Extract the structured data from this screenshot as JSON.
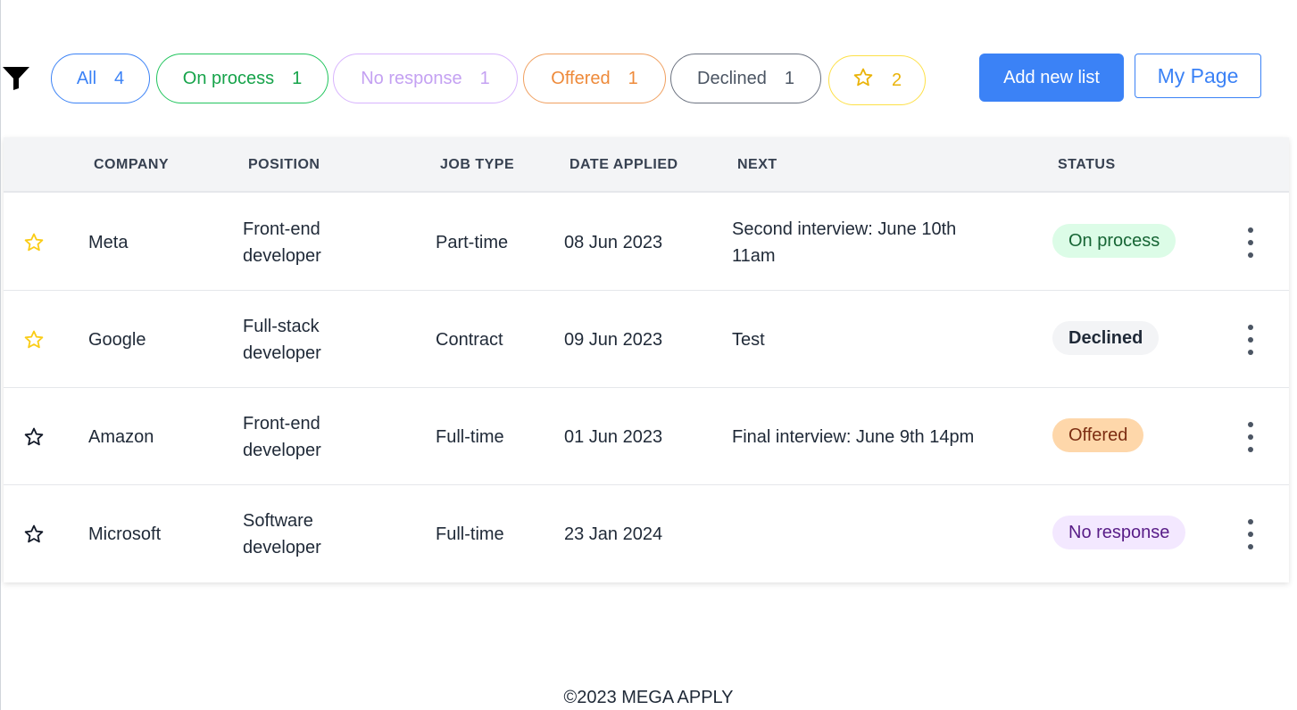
{
  "filters": {
    "icon": "filter-icon",
    "pills": [
      {
        "key": "all",
        "label": "All",
        "count": "4"
      },
      {
        "key": "onprocess",
        "label": "On process",
        "count": "1"
      },
      {
        "key": "noresponse",
        "label": "No response",
        "count": "1"
      },
      {
        "key": "offered",
        "label": "Offered",
        "count": "1"
      },
      {
        "key": "declined",
        "label": "Declined",
        "count": "1"
      },
      {
        "key": "starred",
        "icon": "star-icon",
        "count": "2"
      }
    ]
  },
  "actions": {
    "add_label": "Add new list",
    "mypage_label": "My Page"
  },
  "table": {
    "headers": {
      "company": "COMPANY",
      "position": "POSITION",
      "job_type": "JOB TYPE",
      "date_applied": "DATE APPLIED",
      "next": "NEXT",
      "status": "STATUS"
    },
    "rows": [
      {
        "starred": true,
        "company": "Meta",
        "position_l1": "Front-end",
        "position_l2": "developer",
        "job_type": "Part-time",
        "date": "08 Jun 2023",
        "next_l1": "Second interview: June 10th",
        "next_l2": "11am",
        "status": "On process"
      },
      {
        "starred": true,
        "company": "Google",
        "position_l1": "Full-stack",
        "position_l2": "developer",
        "job_type": "Contract",
        "date": "09 Jun 2023",
        "next_l1": "Test",
        "next_l2": "",
        "status": "Declined"
      },
      {
        "starred": false,
        "company": "Amazon",
        "position_l1": "Front-end",
        "position_l2": "developer",
        "job_type": "Full-time",
        "date": "01 Jun 2023",
        "next_l1": "Final interview: June 9th 14pm",
        "next_l2": "",
        "status": "Offered"
      },
      {
        "starred": false,
        "company": "Microsoft",
        "position_l1": "Software",
        "position_l2": "developer",
        "job_type": "Full-time",
        "date": "23 Jan 2024",
        "next_l1": "",
        "next_l2": "",
        "status": "No response"
      }
    ]
  },
  "colors": {
    "accent": "#3b82f6",
    "star_filled": "#facc15",
    "on_process": "#22c55e",
    "no_response": "#d8b4fe",
    "offered": "#f0a060",
    "declined": "#6b7280"
  },
  "footer": {
    "text": "©2023 MEGA APPLY"
  }
}
